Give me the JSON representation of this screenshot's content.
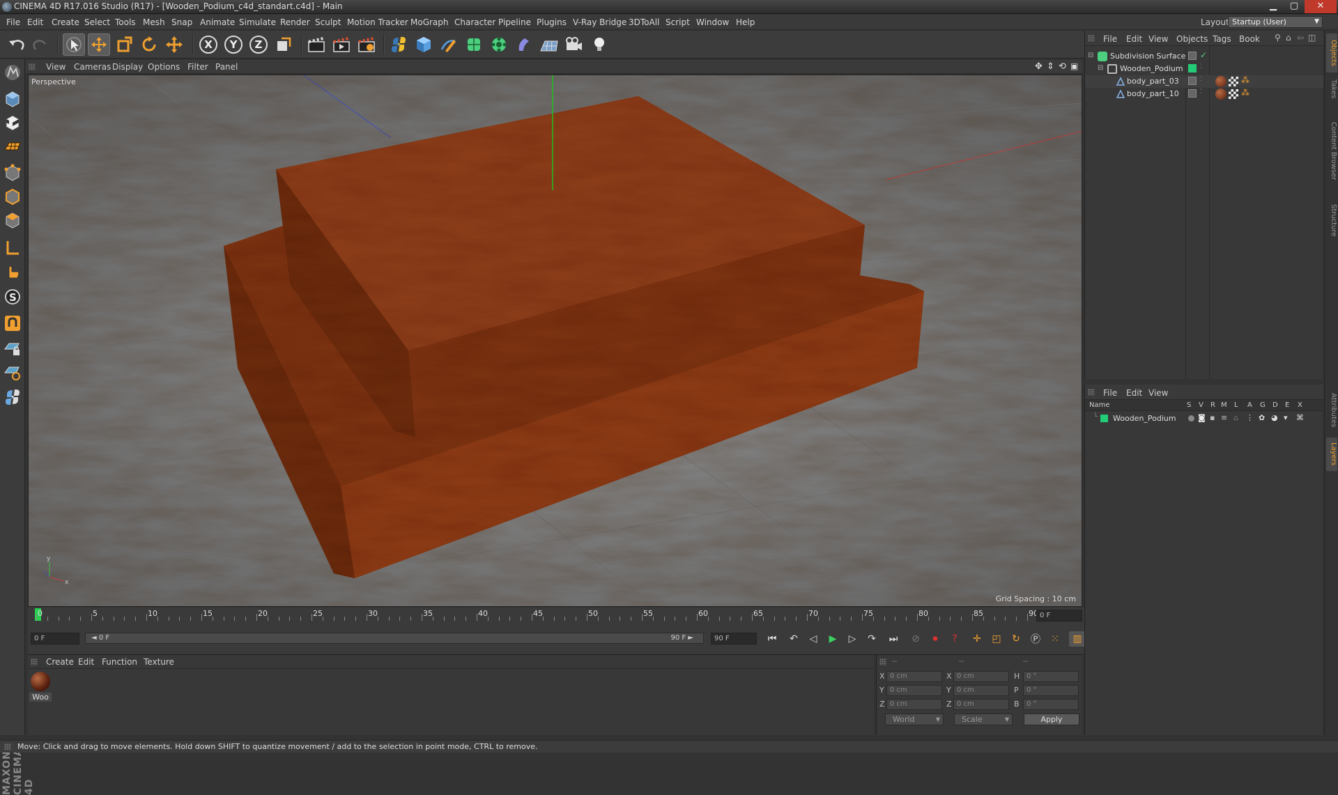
{
  "window": {
    "title": "CINEMA 4D R17.016 Studio (R17) - [Wooden_Podium_c4d_standart.c4d] - Main",
    "minimize": "▁",
    "maximize": "▢",
    "close": "✕"
  },
  "menubar": {
    "items": [
      "File",
      "Edit",
      "Create",
      "Select",
      "Tools",
      "Mesh",
      "Snap",
      "Animate",
      "Simulate",
      "Render",
      "Sculpt",
      "Motion Tracker",
      "MoGraph",
      "Character",
      "Pipeline",
      "Plugins",
      "V-Ray Bridge",
      "3DToAll",
      "Script",
      "Window",
      "Help"
    ],
    "layout_label": "Layout:",
    "layout_value": "Startup (User)"
  },
  "toolbar": {
    "axis_x": "X",
    "axis_y": "Y",
    "axis_z": "Z"
  },
  "viewport": {
    "menu": [
      "View",
      "Cameras",
      "Display",
      "Options",
      "Filter",
      "Panel"
    ],
    "label": "Perspective",
    "grid_spacing": "Grid Spacing : 10 cm",
    "axis_y": "y",
    "axis_x": "x"
  },
  "timeline": {
    "ticks": [
      "0",
      "5",
      "10",
      "15",
      "20",
      "25",
      "30",
      "35",
      "40",
      "45",
      "50",
      "55",
      "60",
      "65",
      "70",
      "75",
      "80",
      "85",
      "90"
    ],
    "current_frame": "0 F",
    "start_field": "0 F",
    "slider_start": "◄ 0 F",
    "slider_end": "90 F ►",
    "end_field": "90 F"
  },
  "materials": {
    "menu": [
      "Create",
      "Edit",
      "Function",
      "Texture"
    ],
    "items": [
      {
        "label": "Woo"
      }
    ]
  },
  "coordinates": {
    "headers": [
      "--",
      "--",
      "--"
    ],
    "rows": [
      {
        "l1": "X",
        "v1": "0 cm",
        "l2": "X",
        "v2": "0 cm",
        "l3": "H",
        "v3": "0 °"
      },
      {
        "l1": "Y",
        "v1": "0 cm",
        "l2": "Y",
        "v2": "0 cm",
        "l3": "P",
        "v3": "0 °"
      },
      {
        "l1": "Z",
        "v1": "0 cm",
        "l2": "Z",
        "v2": "0 cm",
        "l3": "B",
        "v3": "0 °"
      }
    ],
    "world": "World",
    "scale": "Scale",
    "apply": "Apply"
  },
  "objects_panel": {
    "menu": [
      "File",
      "Edit",
      "View",
      "Objects",
      "Tags",
      "Book"
    ],
    "tree": [
      {
        "name": "Subdivision Surface"
      },
      {
        "name": "Wooden_Podium"
      },
      {
        "name": "body_part_03"
      },
      {
        "name": "body_part_10"
      }
    ]
  },
  "layers_panel": {
    "menu": [
      "File",
      "Edit",
      "View"
    ],
    "header_name": "Name",
    "cols": [
      "S",
      "V",
      "R",
      "M",
      "L",
      "A",
      "G",
      "D",
      "E",
      "X"
    ],
    "rows": [
      {
        "name": "Wooden_Podium"
      }
    ]
  },
  "right_tabs": [
    "Objects",
    "Takes",
    "Content Browser",
    "Structure",
    "Attributes",
    "Layers"
  ],
  "status": "Move: Click and drag to move elements. Hold down SHIFT to quantize movement / add to the selection in point mode, CTRL to remove.",
  "maxon": "MAXON CINEMA 4D",
  "colors": {
    "wood": "#7a2f10",
    "accent": "#f0a030",
    "layer_green": "#22cc77"
  }
}
